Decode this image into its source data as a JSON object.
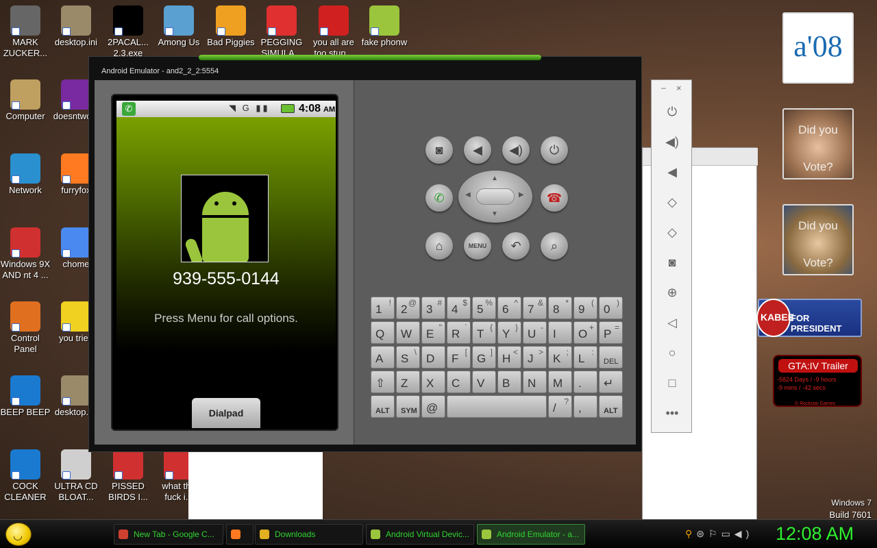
{
  "desktop": {
    "icons": [
      {
        "label": "MARK ZUCKER...",
        "icon": "person-icon",
        "color": "#666"
      },
      {
        "label": "desktop.ini",
        "icon": "settings-file-icon",
        "color": "#9a8a6a"
      },
      {
        "label": "2PACAL... 2.3.exe",
        "icon": "cmd-icon",
        "color": "#000"
      },
      {
        "label": "Among Us",
        "icon": "among-us-icon",
        "color": "#5aa0d0"
      },
      {
        "label": "Bad Piggies",
        "icon": "bad-piggies-icon",
        "color": "#f0a020"
      },
      {
        "label": "PEGGING SIMULA...",
        "icon": "pegging-icon",
        "color": "#e03030"
      },
      {
        "label": "you all are too stup...",
        "icon": "dev-cpp-icon",
        "color": "#d02020"
      },
      {
        "label": "fake phonw",
        "icon": "android-icon",
        "color": "#9ac53c"
      },
      {
        "label": "Computer",
        "icon": "computer-icon",
        "color": "#c0a060"
      },
      {
        "label": "doesntwo...",
        "icon": "yahoo-icon",
        "color": "#7a2aa0"
      },
      {
        "label": "Network",
        "icon": "network-icon",
        "color": "#2a90d0"
      },
      {
        "label": "furryfox",
        "icon": "firefox-icon",
        "color": "#ff7a20"
      },
      {
        "label": "Windows 9X AND nt 4 ...",
        "icon": "recycle-bin-icon",
        "color": "#d03030"
      },
      {
        "label": "chome",
        "icon": "chrome-icon",
        "color": "#4a8af0"
      },
      {
        "label": "Control Panel",
        "icon": "control-panel-icon",
        "color": "#e07020"
      },
      {
        "label": "you tried",
        "icon": "star-icon",
        "color": "#f0d020"
      },
      {
        "label": "BEEP BEEP",
        "icon": "blue-app-icon",
        "color": "#1a7ad0"
      },
      {
        "label": "desktop.ini",
        "icon": "settings-file-icon",
        "color": "#9a8a6a"
      },
      {
        "label": "COCK CLEANER",
        "icon": "blue-app-icon",
        "color": "#1a7ad0"
      },
      {
        "label": "ULTRA CD BLOAT...",
        "icon": "cd-icon",
        "color": "#cfcfcf"
      },
      {
        "label": "PISSED BIRDS I...",
        "icon": "angry-birds-icon",
        "color": "#d03030"
      },
      {
        "label": "what the fuck i...",
        "icon": "angry-birds-icon",
        "color": "#d03030"
      }
    ],
    "win_version": "Windows 7",
    "build": "Build 7601"
  },
  "emulator": {
    "title": "Android Emulator - and2_2_2:5554",
    "status_time": "4:08",
    "status_ampm": "AM",
    "phone_number": "939-555-0144",
    "hint": "Press Menu for call options.",
    "dialpad_label": "Dialpad",
    "menu_label": "MENU",
    "keyboard": {
      "row1": [
        [
          "1",
          "!"
        ],
        [
          "2",
          "@"
        ],
        [
          "3",
          "#"
        ],
        [
          "4",
          "$"
        ],
        [
          "5",
          "%"
        ],
        [
          "6",
          "^"
        ],
        [
          "7",
          "&"
        ],
        [
          "8",
          "*"
        ],
        [
          "9",
          "("
        ],
        [
          "0",
          ")"
        ]
      ],
      "row2": [
        [
          "Q",
          ""
        ],
        [
          "W",
          ""
        ],
        [
          "E",
          "\""
        ],
        [
          "R",
          "`"
        ],
        [
          "T",
          "{"
        ],
        [
          "Y",
          "}"
        ],
        [
          "U",
          "-"
        ],
        [
          "I",
          ""
        ],
        [
          "O",
          "+"
        ],
        [
          "P",
          "="
        ]
      ],
      "row3": [
        [
          "A",
          ""
        ],
        [
          "S",
          "\\"
        ],
        [
          "D",
          ""
        ],
        [
          "F",
          "["
        ],
        [
          "G",
          "]"
        ],
        [
          "H",
          "<"
        ],
        [
          "J",
          ">"
        ],
        [
          "K",
          ";"
        ],
        [
          "L",
          ":"
        ],
        [
          "DEL",
          ""
        ]
      ],
      "row4": [
        [
          "⇧",
          ""
        ],
        [
          "Z",
          ""
        ],
        [
          "X",
          ""
        ],
        [
          "C",
          ""
        ],
        [
          "V",
          ""
        ],
        [
          "B",
          ""
        ],
        [
          "N",
          ""
        ],
        [
          "M",
          ""
        ],
        [
          ".",
          ""
        ],
        [
          "↵",
          ""
        ]
      ],
      "row5": [
        [
          "ALT",
          ""
        ],
        [
          "SYM",
          ""
        ],
        [
          "@",
          ""
        ],
        [
          "",
          ""
        ],
        [
          "/",
          "?"
        ],
        [
          ",",
          ""
        ],
        [
          "ALT",
          ""
        ]
      ]
    }
  },
  "gadgets": {
    "logo_text": "a'08",
    "did_you": "Did you",
    "vote": "Vote?",
    "president": "FOR PRESIDENT",
    "kabee": "KABEE",
    "gta_title": "GTA:IV  Trailer",
    "gta_line1": "-5824 Days / -9 hours",
    "gta_line2": "-9 mins / -42 secs",
    "gta_footer": "© Rockstar Games"
  },
  "taskbar": {
    "items": [
      {
        "label": "New Tab - Google C...",
        "color": "#d04030",
        "icon": "chrome-icon"
      },
      {
        "label": "",
        "color": "#ff7a20",
        "icon": "firefox-icon"
      },
      {
        "label": "Downloads",
        "color": "#e0b020",
        "icon": "folder-icon"
      },
      {
        "label": "Android Virtual Devic...",
        "color": "#9ac53c",
        "icon": "android-icon"
      },
      {
        "label": "Android Emulator - a...",
        "color": "#9ac53c",
        "icon": "android-icon"
      }
    ],
    "clock": "12:08 AM"
  }
}
